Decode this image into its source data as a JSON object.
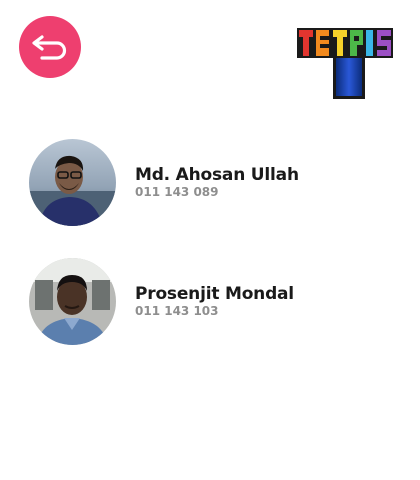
{
  "header": {
    "back_icon": "undo-arrow-icon",
    "logo_text": "TETRIS"
  },
  "contacts": [
    {
      "name": "Md. Ahosan Ullah",
      "phone": "011 143 089"
    },
    {
      "name": "Prosenjit Mondal",
      "phone": "011 143 103"
    }
  ],
  "colors": {
    "accent": "#ee3f6f",
    "name_text": "#1a1a1a",
    "phone_text": "#8e8e8e"
  }
}
